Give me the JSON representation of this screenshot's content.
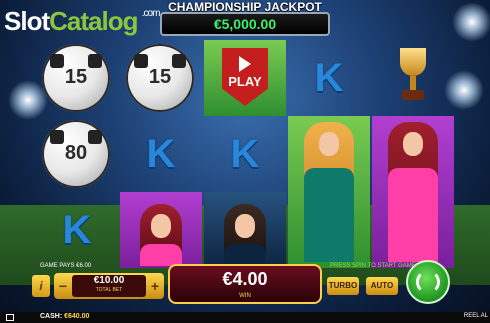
{
  "logo": {
    "part1": "Slot",
    "part2": "Catalog",
    "suffix": ".com"
  },
  "jackpot": {
    "title": "CHAMPIONSHIP JACKPOT",
    "value": "€5,000.00"
  },
  "reels": [
    [
      {
        "type": "ball",
        "value": "15"
      },
      {
        "type": "ball",
        "value": "80"
      },
      {
        "type": "letter",
        "value": "K"
      }
    ],
    [
      {
        "type": "ball",
        "value": "15"
      },
      {
        "type": "letter",
        "value": "K"
      },
      {
        "type": "character",
        "value": "red-haired-player"
      }
    ],
    [
      {
        "type": "play",
        "value": "PLAY"
      },
      {
        "type": "letter",
        "value": "K"
      },
      {
        "type": "character",
        "value": "bearded-player"
      }
    ],
    [
      {
        "type": "letter",
        "value": "K"
      },
      {
        "type": "character",
        "value": "blonde-player"
      },
      {
        "type": "character",
        "value": "blonde-player"
      }
    ],
    [
      {
        "type": "trophy",
        "value": "trophy"
      },
      {
        "type": "character",
        "value": "red-haired-player"
      },
      {
        "type": "character",
        "value": "red-haired-player"
      }
    ]
  ],
  "controls": {
    "game_pays": "GAME PAYS €6.00",
    "press_spin": "PRESS SPIN TO START GAME",
    "info_label": "i",
    "minus_label": "−",
    "plus_label": "+",
    "total_bet_value": "€10.00",
    "total_bet_label": "TOTAL BET",
    "win_value": "€4.00",
    "win_label": "WIN",
    "turbo_label": "TURBO",
    "auto_label": "AUTO"
  },
  "footer": {
    "cash_label": "CASH:",
    "cash_value": "€640.00",
    "reel_all": "REEL AL"
  },
  "colors": {
    "letter_k": "#2a86d8",
    "jackpot_digits": "#3df06a",
    "accent_gold": "#ffd84d"
  }
}
